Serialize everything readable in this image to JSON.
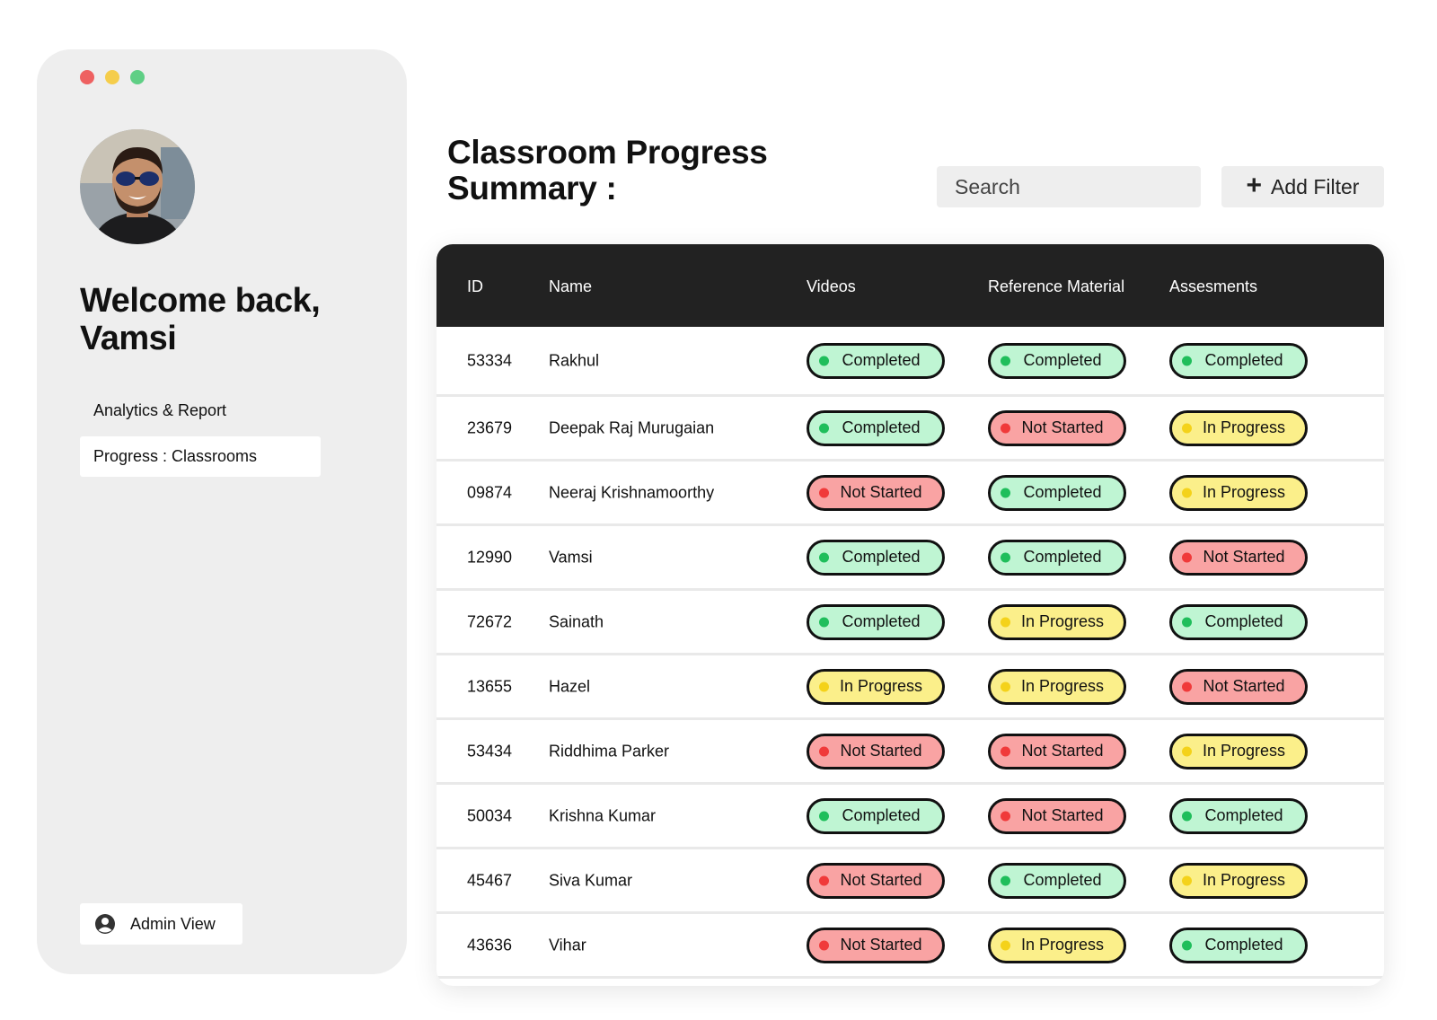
{
  "sidebar": {
    "welcome_line1": "Welcome back,",
    "welcome_line2": "Vamsi",
    "nav": [
      {
        "label": "Analytics & Report"
      },
      {
        "label": "Progress : Classrooms"
      }
    ],
    "admin_label": "Admin View"
  },
  "header": {
    "title_line1": "Classroom Progress",
    "title_line2": "Summary :",
    "search_placeholder": "Search",
    "add_filter_label": "Add Filter"
  },
  "table": {
    "columns": [
      "ID",
      "Name",
      "Videos",
      "Reference Material",
      "Assesments"
    ],
    "rows": [
      {
        "id": "53334",
        "name": "Rakhul",
        "videos": "Completed",
        "reference": "Completed",
        "assessments": "Completed"
      },
      {
        "id": "23679",
        "name": "Deepak Raj Murugaian",
        "videos": "Completed",
        "reference": "Not Started",
        "assessments": "In Progress"
      },
      {
        "id": "09874",
        "name": "Neeraj Krishnamoorthy",
        "videos": "Not Started",
        "reference": "Completed",
        "assessments": "In Progress"
      },
      {
        "id": "12990",
        "name": "Vamsi",
        "videos": "Completed",
        "reference": "Completed",
        "assessments": "Not Started"
      },
      {
        "id": "72672",
        "name": "Sainath",
        "videos": "Completed",
        "reference": "In Progress",
        "assessments": "Completed"
      },
      {
        "id": "13655",
        "name": "Hazel",
        "videos": "In Progress",
        "reference": "In Progress",
        "assessments": "Not Started"
      },
      {
        "id": "53434",
        "name": "Riddhima Parker",
        "videos": "Not Started",
        "reference": "Not Started",
        "assessments": "In Progress"
      },
      {
        "id": "50034",
        "name": "Krishna Kumar",
        "videos": "Completed",
        "reference": "Not Started",
        "assessments": "Completed"
      },
      {
        "id": "45467",
        "name": "Siva Kumar",
        "videos": "Not Started",
        "reference": "Completed",
        "assessments": "In Progress"
      },
      {
        "id": "43636",
        "name": "Vihar",
        "videos": "Not Started",
        "reference": "In Progress",
        "assessments": "Completed"
      }
    ]
  },
  "status_colors": {
    "Completed": {
      "bg": "#bff5d3",
      "dot": "#1fbe5b"
    },
    "Not Started": {
      "bg": "#f9a3a3",
      "dot": "#f03a3a"
    },
    "In Progress": {
      "bg": "#fbef8a",
      "dot": "#f4d21a"
    }
  },
  "window_dot_colors": [
    "#ee6161",
    "#f5cd4b",
    "#5fcf85"
  ],
  "icons": {
    "admin": "user-circle-icon",
    "add": "plus-icon"
  }
}
